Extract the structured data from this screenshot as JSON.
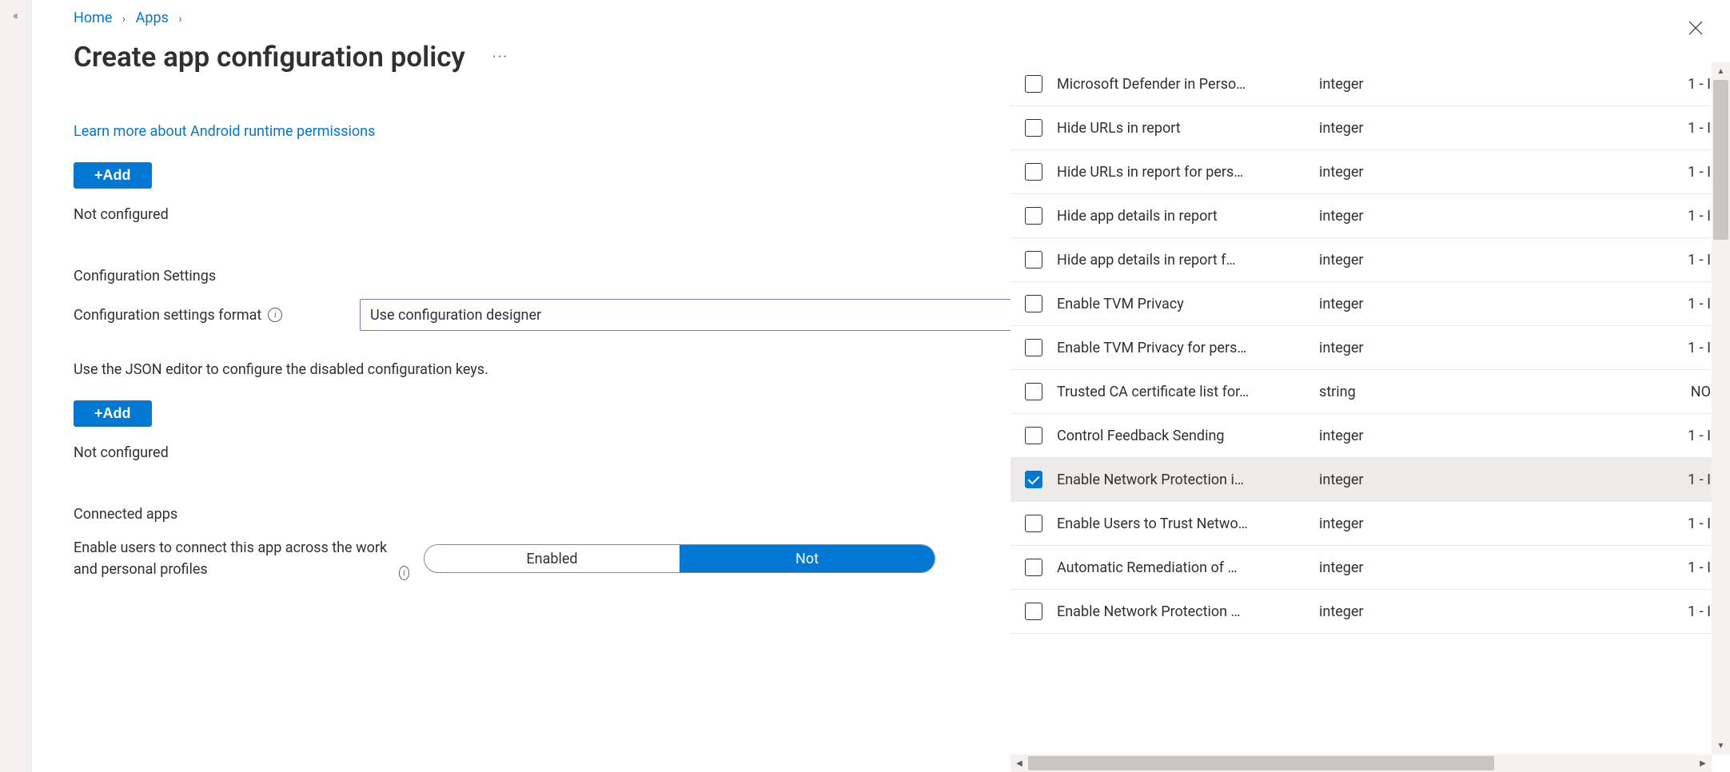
{
  "breadcrumb": {
    "home": "Home",
    "apps": "Apps"
  },
  "page": {
    "title": "Create app configuration policy",
    "learn_link": "Learn more about Android runtime permissions",
    "add_label": "+Add",
    "not_configured": "Not configured",
    "config_heading": "Configuration Settings",
    "format_label": "Configuration settings format",
    "format_value": "Use configuration designer",
    "json_hint": "Use the JSON editor to configure the disabled configuration keys.",
    "connected_heading": "Connected apps",
    "connected_desc": "Enable users to connect this app across the work and personal profiles",
    "toggle_enabled": "Enabled",
    "toggle_not": "Not"
  },
  "keys": [
    {
      "name": "Microsoft Defender in Perso…",
      "type": "integer",
      "value": "1 - I",
      "checked": false
    },
    {
      "name": "Hide URLs in report",
      "type": "integer",
      "value": "1 - I",
      "checked": false
    },
    {
      "name": "Hide URLs in report for pers…",
      "type": "integer",
      "value": "1 - I",
      "checked": false
    },
    {
      "name": "Hide app details in report",
      "type": "integer",
      "value": "1 - I",
      "checked": false
    },
    {
      "name": "Hide app details in report f…",
      "type": "integer",
      "value": "1 - I",
      "checked": false
    },
    {
      "name": "Enable TVM Privacy",
      "type": "integer",
      "value": "1 - I",
      "checked": false
    },
    {
      "name": "Enable TVM Privacy for pers…",
      "type": "integer",
      "value": "1 - I",
      "checked": false
    },
    {
      "name": "Trusted CA certificate list for…",
      "type": "string",
      "value": "NO",
      "checked": false
    },
    {
      "name": "Control Feedback Sending",
      "type": "integer",
      "value": "1 - I",
      "checked": false
    },
    {
      "name": "Enable Network Protection i…",
      "type": "integer",
      "value": "1 - I",
      "checked": true
    },
    {
      "name": "Enable Users to Trust Netwo…",
      "type": "integer",
      "value": "1 - I",
      "checked": false
    },
    {
      "name": "Automatic Remediation of …",
      "type": "integer",
      "value": "1 - I",
      "checked": false
    },
    {
      "name": "Enable Network Protection …",
      "type": "integer",
      "value": "1 - I",
      "checked": false
    }
  ]
}
